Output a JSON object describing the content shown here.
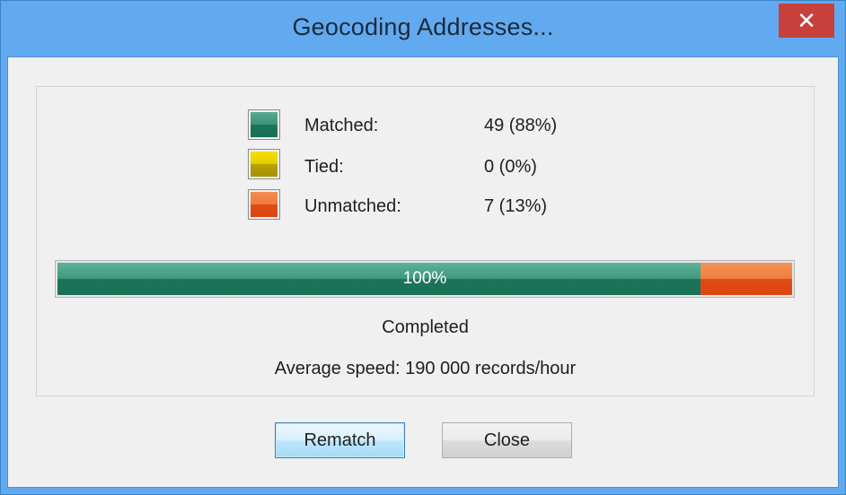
{
  "window": {
    "title": "Geocoding Addresses...",
    "close_glyph": "✕"
  },
  "stats": [
    {
      "label": "Matched:",
      "value": "49 (88%)",
      "color": "#1b7459"
    },
    {
      "label": "Tied:",
      "value": "0 (0%)",
      "color": "#d8c000"
    },
    {
      "label": "Unmatched:",
      "value": "7 (13%)",
      "color": "#e04b16"
    }
  ],
  "progress": {
    "text": "100%",
    "matched_fraction": 0.875,
    "tied_fraction": 0,
    "unmatched_fraction": 0.125
  },
  "status": "Completed",
  "speed": "Average speed:  190 000 records/hour",
  "buttons": {
    "rematch": "Rematch",
    "close": "Close"
  }
}
